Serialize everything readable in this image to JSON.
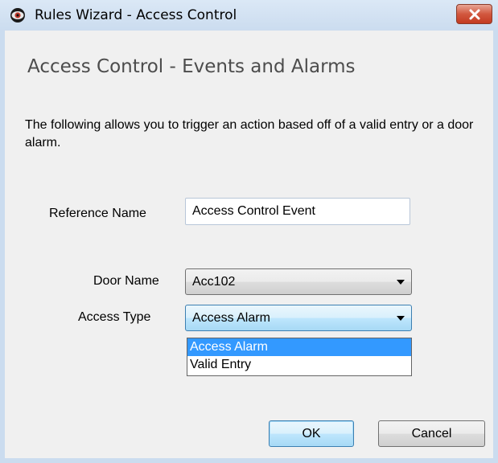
{
  "window": {
    "title": "Rules Wizard - Access Control"
  },
  "page": {
    "heading": "Access Control - Events and Alarms",
    "description": "The following allows you to trigger an action based off of a valid entry or a door alarm."
  },
  "form": {
    "reference_name": {
      "label": "Reference Name",
      "value": "Access Control Event"
    },
    "door_name": {
      "label": "Door Name",
      "value": "Acc102"
    },
    "access_type": {
      "label": "Access Type",
      "value": "Access Alarm",
      "options": [
        "Access Alarm",
        "Valid Entry"
      ],
      "highlighted_option": "Access Alarm"
    }
  },
  "buttons": {
    "ok": "OK",
    "cancel": "Cancel"
  },
  "icons": {
    "app": "eye-icon",
    "close": "close-icon",
    "dropdown": "chevron-down-icon"
  },
  "colors": {
    "close_button": "#c74a30",
    "selection": "#3399ff",
    "focus_border": "#3c7fb1"
  }
}
